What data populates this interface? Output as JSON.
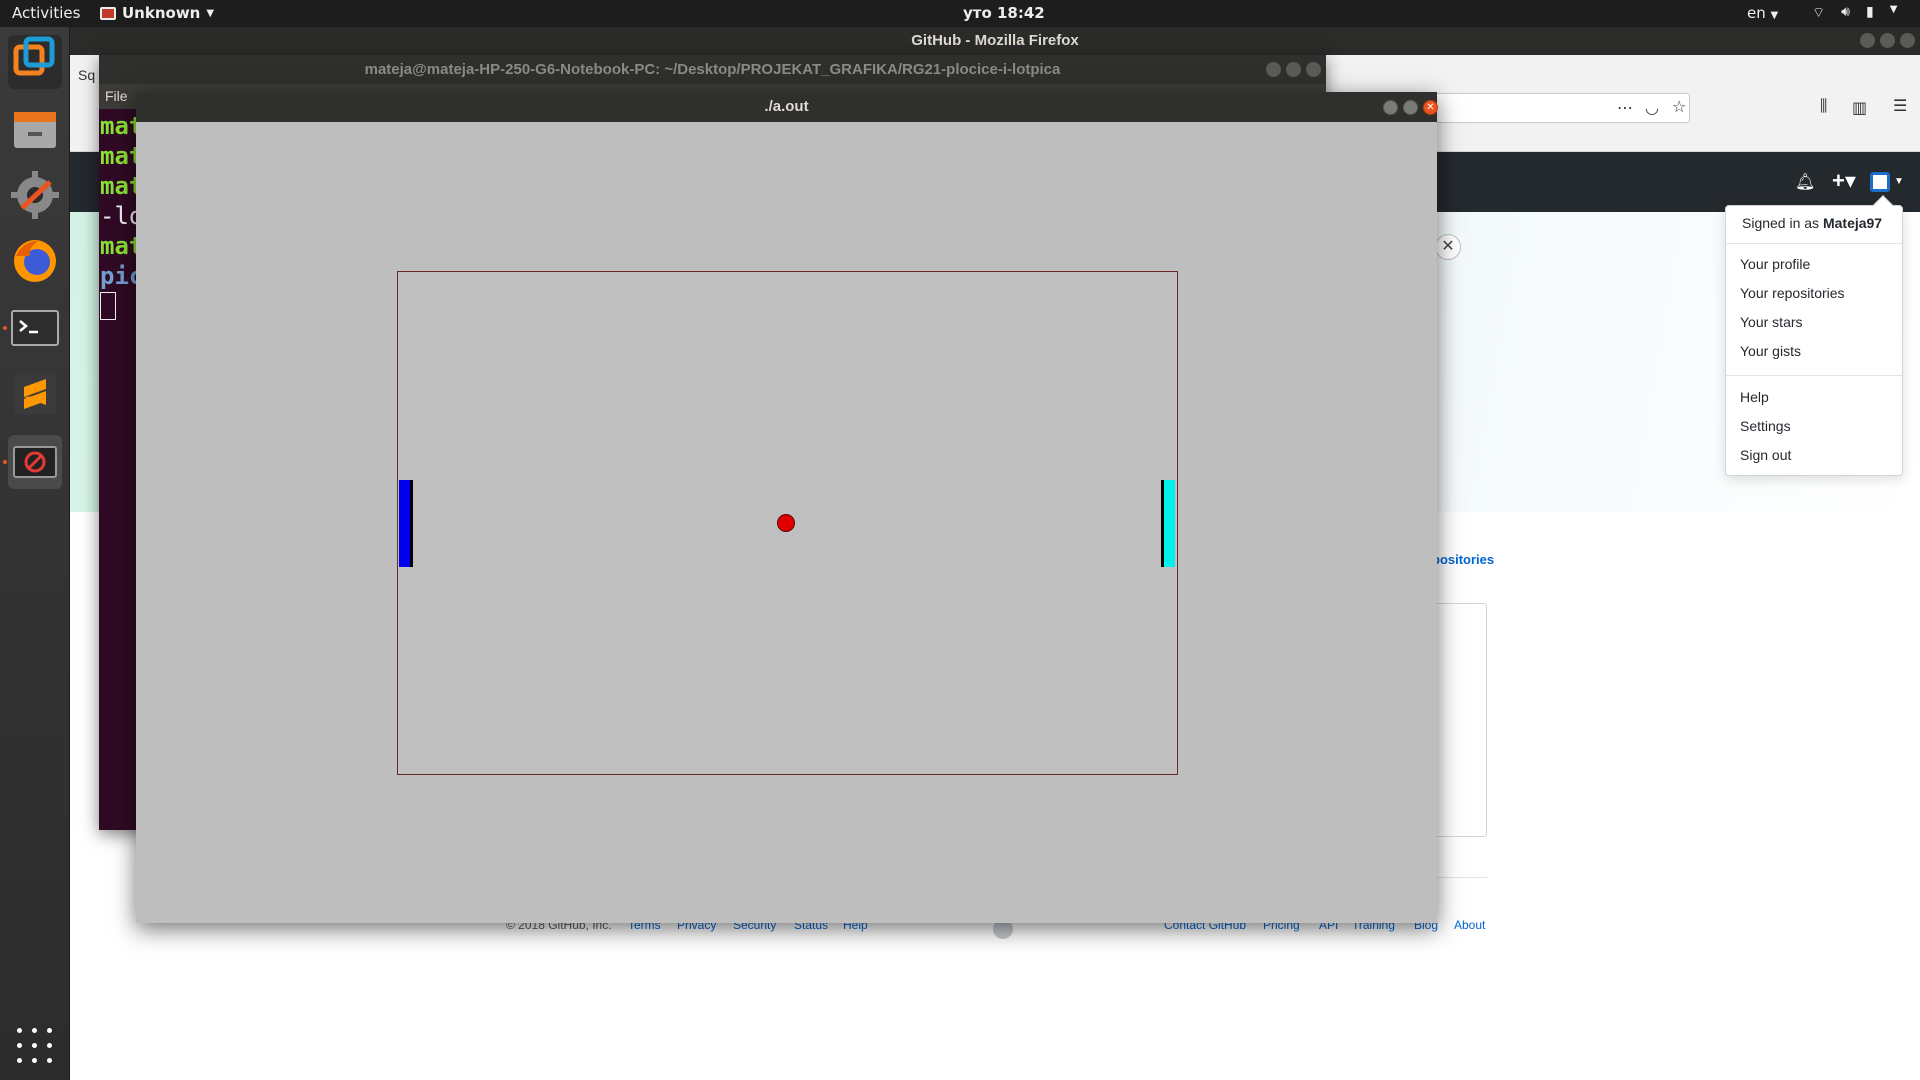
{
  "topbar": {
    "activities": "Activities",
    "app_name": "Unknown",
    "clock": "уто 18:42",
    "lang": "en",
    "status_icons": [
      "wifi-icon",
      "volume-icon",
      "battery-icon",
      "caret-down-icon"
    ]
  },
  "firefox": {
    "title": "GitHub - Mozilla Firefox",
    "tab_fragment": "Sq",
    "toolbar_icons": [
      "back-icon",
      "more-icon",
      "pocket-icon",
      "star-icon",
      "library-icon",
      "sidebar-icon",
      "hamburger-menu-icon"
    ]
  },
  "github": {
    "menu": {
      "signed_in_prefix": "Signed in as",
      "username": "Mateja97",
      "items_group1": [
        "Your profile",
        "Your repositories",
        "Your stars",
        "Your gists"
      ],
      "items_group2": [
        "Help",
        "Settings",
        "Sign out"
      ]
    },
    "repos_link_fragment": "positories",
    "footer": {
      "copyright": "© 2018 GitHub, Inc.",
      "left_links": [
        "Terms",
        "Privacy",
        "Security",
        "Status",
        "Help"
      ],
      "right_links": [
        "Contact GitHub",
        "Pricing",
        "API",
        "Training",
        "Blog",
        "About"
      ]
    }
  },
  "terminal": {
    "title": "mateja@mateja-HP-250-G6-Notebook-PC: ~/Desktop/PROJEKAT_GRAFIKA/RG21-plocice-i-lotpica",
    "menu_first": "File",
    "lines": [
      {
        "text": "mat",
        "style": "green"
      },
      {
        "text": "mat",
        "style": "green"
      },
      {
        "text": "mat",
        "style": "green"
      },
      {
        "text": "-lo",
        "style": "white"
      },
      {
        "text": "mat",
        "style": "green"
      },
      {
        "text": "pic",
        "style": "blue"
      }
    ]
  },
  "game": {
    "window_title": "./a.out",
    "colors": {
      "background": "#bebebe",
      "court_border": "#6b2a2a",
      "left_paddle": "#0000ee",
      "right_paddle": "#00f0f0",
      "ball": "#e00000"
    }
  },
  "launcher": {
    "apps": [
      "vmware-icon",
      "files-icon",
      "software-updater-icon",
      "firefox-icon",
      "terminal-icon",
      "sublime-text-icon",
      "blocked-app-icon"
    ],
    "show_apps": "app-grid-icon"
  }
}
